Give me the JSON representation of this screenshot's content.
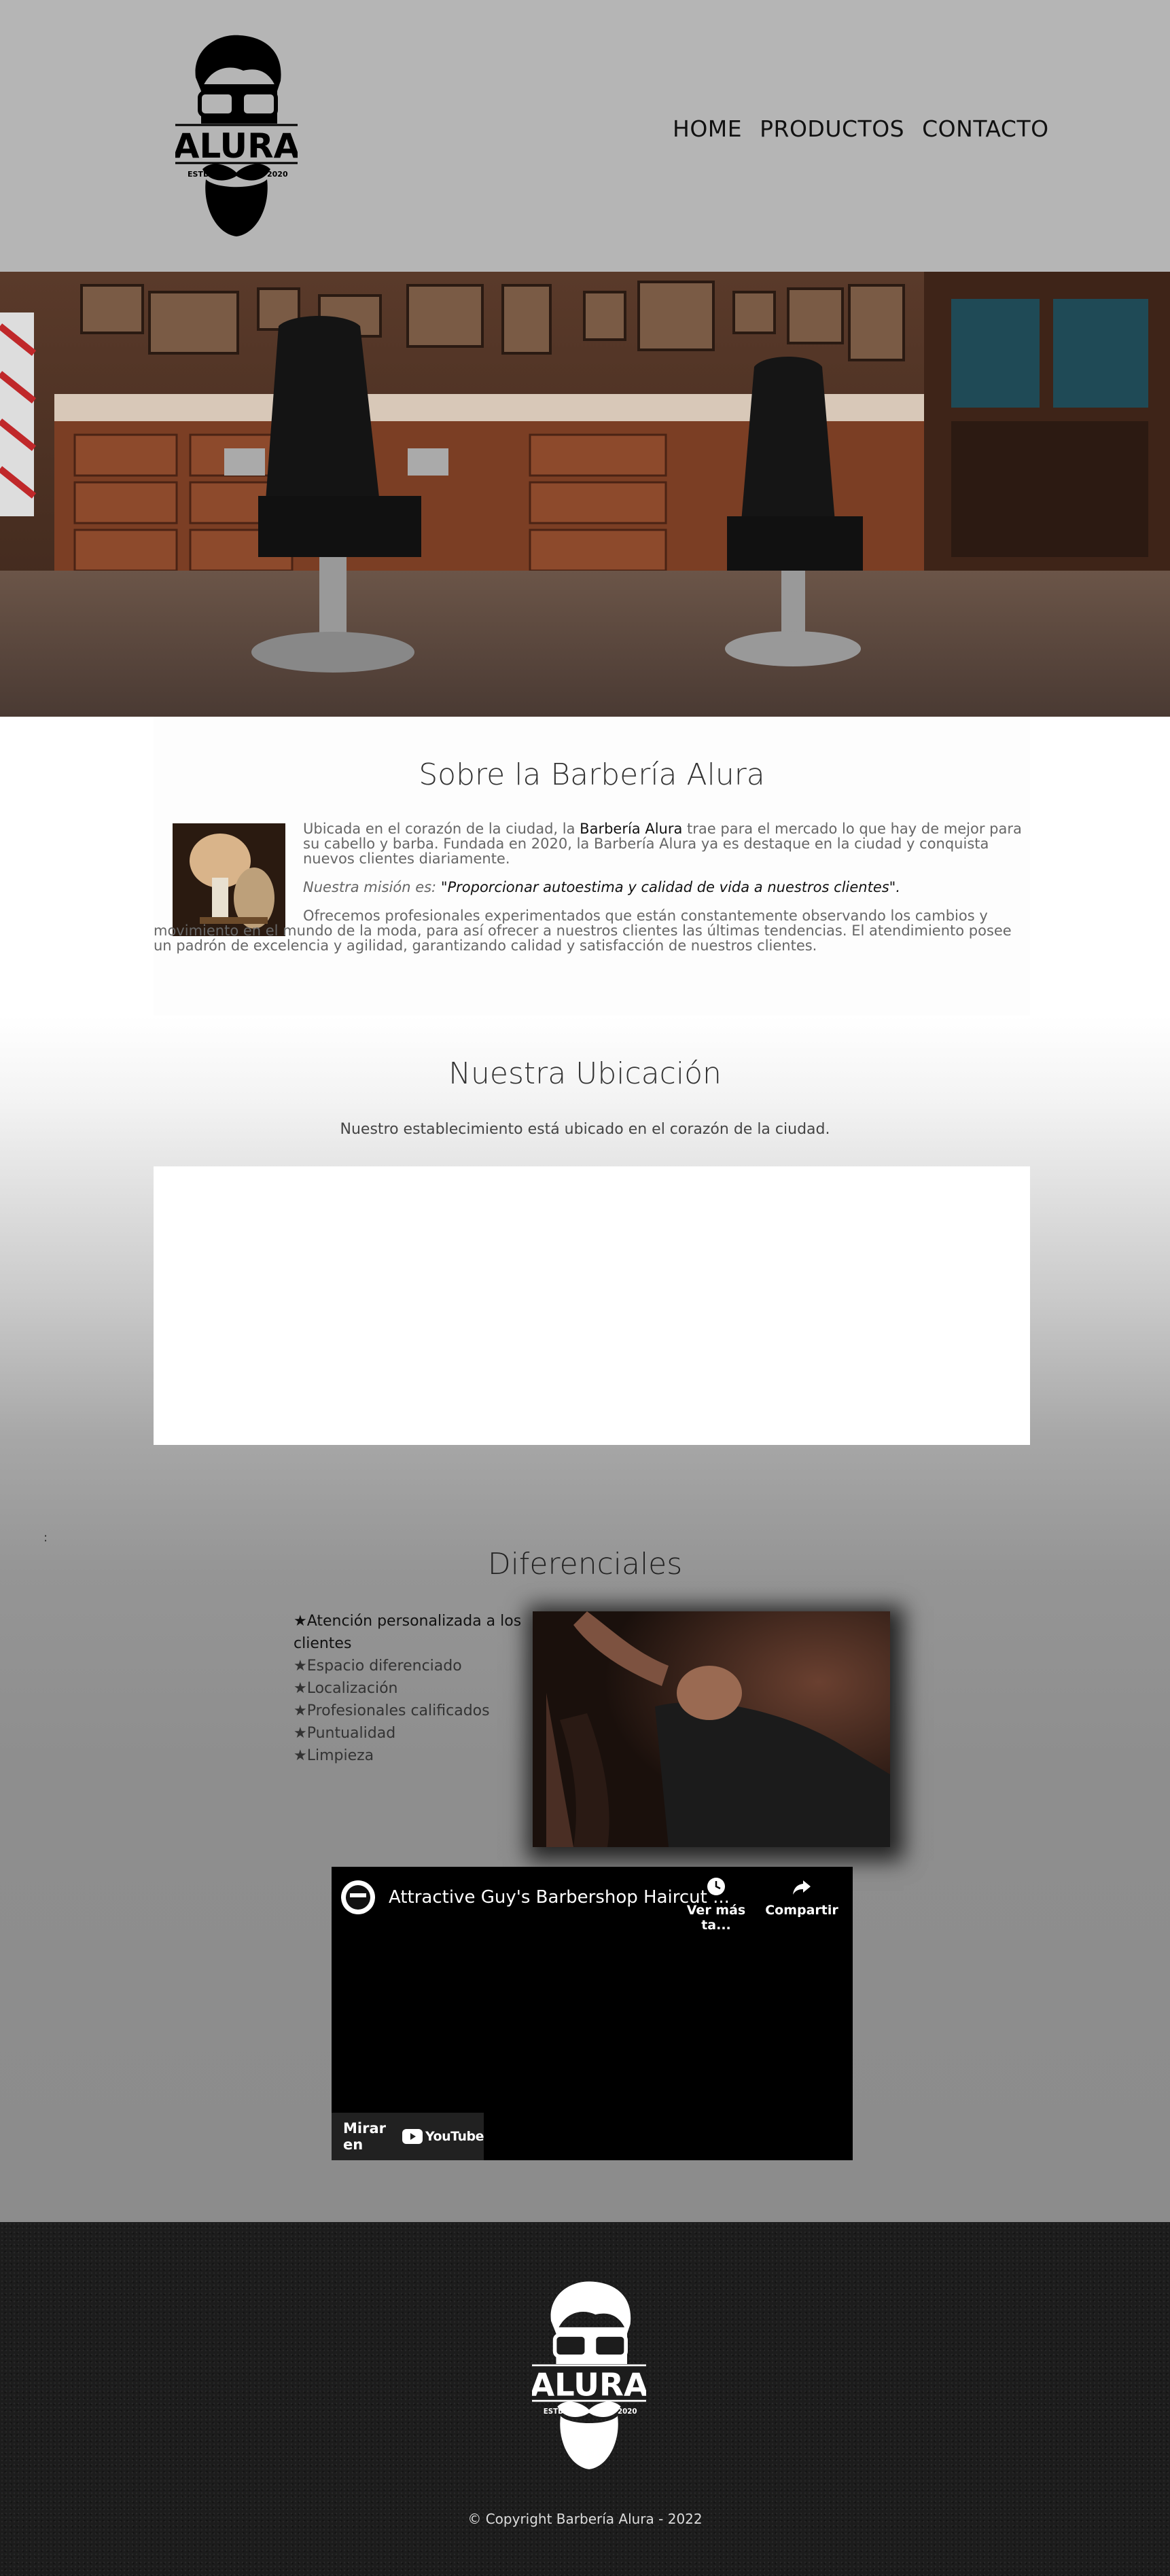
{
  "brand": {
    "name": "ALURA",
    "est_left": "ESTD",
    "est_right": "2020"
  },
  "nav": {
    "items": [
      "HOME",
      "PRODUCTOS",
      "CONTACTO"
    ]
  },
  "about": {
    "title": "Sobre la Barbería Alura",
    "p1_before": "Ubicada en el corazón de la ciudad, la ",
    "p1_brand": "Barbería Alura",
    "p1_after": " trae para el mercado lo que hay de mejor para su cabello y barba. Fundada en 2020, la Barbería Alura ya es destaque en la ciudad y conquista nuevos clientes diariamente.",
    "mission_label": "Nuestra misión es: ",
    "mission_text": "\"Proporcionar autoestima y calidad de vida a nuestros clientes\".",
    "p3": "Ofrecemos profesionales experimentados que están constantemente observando los cambios y movimiento en el mundo de la moda, para así ofrecer a nuestros clientes las últimas tendencias. El atendimiento posee un padrón de excelencia y agilidad, garantizando calidad y satisfacción de nuestros clientes."
  },
  "location": {
    "title": "Nuestra Ubicación",
    "subtitle": "Nuestro establecimiento está ubicado en el corazón de la ciudad."
  },
  "diferenciales": {
    "colon": ":",
    "title": "Diferenciales",
    "items": [
      "★Atención personalizada a los clientes",
      "★Espacio diferenciado",
      "★Localización",
      "★Profesionales calificados",
      "★Puntualidad",
      "★Limpieza"
    ]
  },
  "video": {
    "title": "Attractive Guy's Barbershop Haircut ...",
    "watch_later": "Ver más ta...",
    "share": "Compartir",
    "watch_on": "Mirar en",
    "youtube": "YouTube"
  },
  "footer": {
    "copyright": "© Copyright Barbería Alura - 2022"
  },
  "colors": {
    "header_bg": "#b5b5b5",
    "footer_bg": "#1c1c1c",
    "text_dark": "#111111"
  }
}
